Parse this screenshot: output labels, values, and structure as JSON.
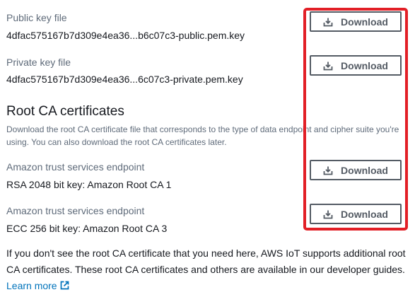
{
  "public_key": {
    "label": "Public key file",
    "filename": "4dfac575167b7d309e4ea36...b6c07c3-public.pem.key",
    "button_label": "Download"
  },
  "private_key": {
    "label": "Private key file",
    "filename": "4dfac575167b7d309e4ea36...6c07c3-private.pem.key",
    "button_label": "Download"
  },
  "root_ca": {
    "title": "Root CA certificates",
    "description": "Download the root CA certificate file that corresponds to the type of data endpoint and cipher suite you're using. You can also download the root CA certificates later.",
    "certs": [
      {
        "label": "Amazon trust services endpoint",
        "value": "RSA 2048 bit key: Amazon Root CA 1",
        "button_label": "Download"
      },
      {
        "label": "Amazon trust services endpoint",
        "value": "ECC 256 bit key: Amazon Root CA 3",
        "button_label": "Download"
      }
    ]
  },
  "footer": {
    "text": "If you don't see the root CA certificate that you need here, AWS IoT supports additional root CA certificates. These root CA certificates and others are available in our developer guides.",
    "link_label": "Learn more"
  },
  "icons": {
    "download": "download-icon",
    "external": "external-link-icon"
  },
  "colors": {
    "highlight_border": "#e21f26",
    "button_border": "#545b64",
    "link": "#0073bb",
    "secondary_text": "#5f6b7a"
  }
}
